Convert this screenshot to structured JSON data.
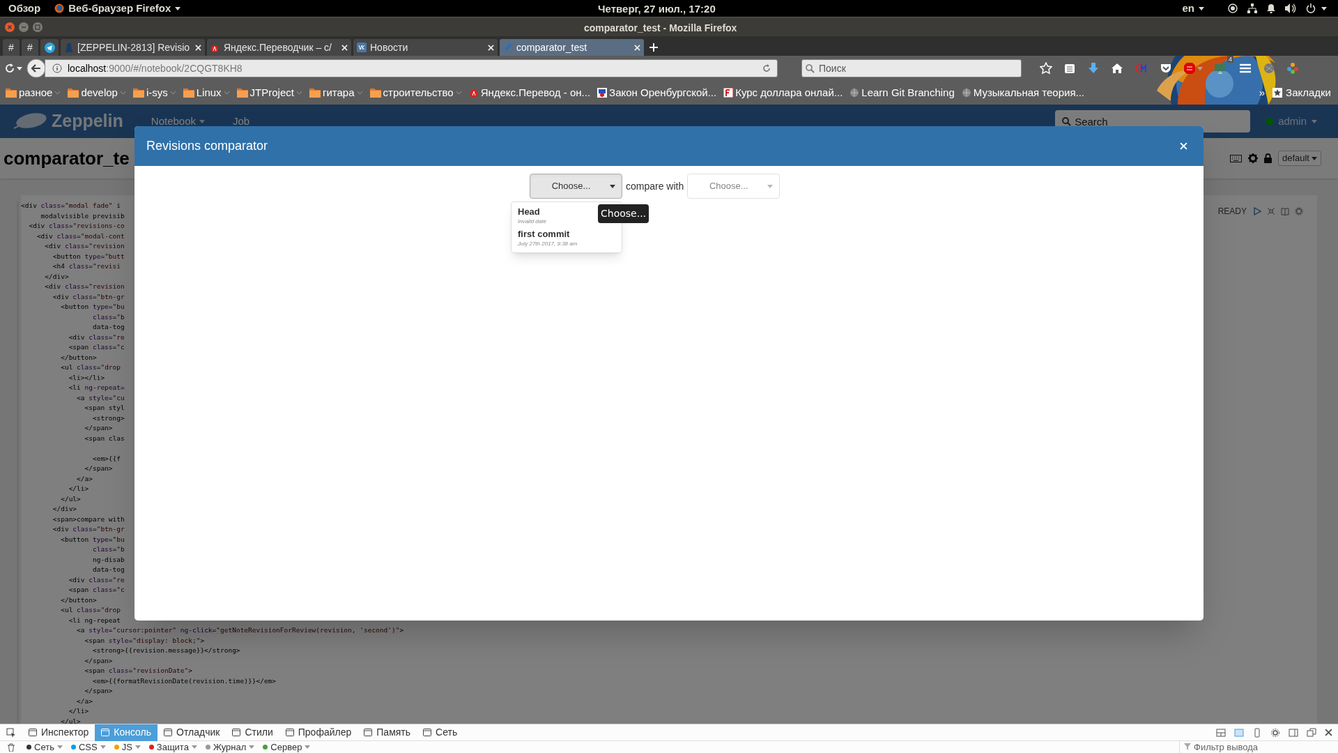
{
  "system_bar": {
    "activities": "Обзор",
    "app_menu": "Веб-браузер Firefox",
    "clock": "Четверг, 27 июл., 17:20",
    "language": "en"
  },
  "window": {
    "title": "comparator_test - Mozilla Firefox"
  },
  "tabs": [
    {
      "kind": "pinned",
      "label": "#",
      "selected": false
    },
    {
      "kind": "pinned",
      "label": "#",
      "selected": false
    },
    {
      "kind": "pinned-icon",
      "selected": false
    },
    {
      "kind": "page",
      "label": "[ZEPPELIN-2813] Revisio",
      "selected": false
    },
    {
      "kind": "page",
      "label": "Яндекс.Переводчик – с/",
      "selected": false
    },
    {
      "kind": "page",
      "label": "Новости",
      "selected": false
    },
    {
      "kind": "page",
      "label": "comparator_test",
      "selected": true
    }
  ],
  "address_bar": {
    "host": "localhost",
    "path": ":9000/#/notebook/2CQGT8KH8"
  },
  "search": {
    "placeholder": "Поиск"
  },
  "toolbar_badge": "4",
  "bookmarks": [
    {
      "kind": "folder",
      "label": "разное"
    },
    {
      "kind": "folder",
      "label": "develop"
    },
    {
      "kind": "folder",
      "label": "i-sys"
    },
    {
      "kind": "folder",
      "label": "Linux"
    },
    {
      "kind": "folder",
      "label": "JTProject"
    },
    {
      "kind": "folder",
      "label": "гитара"
    },
    {
      "kind": "folder",
      "label": "строительство"
    },
    {
      "kind": "site",
      "label": "Яндекс.Перевод - он..."
    },
    {
      "kind": "site",
      "label": "Закон Оренбургской..."
    },
    {
      "kind": "site",
      "label": "Курс доллара онлай..."
    },
    {
      "kind": "site",
      "label": "Learn Git Branching"
    },
    {
      "kind": "site",
      "label": "Музыкальная теория..."
    }
  ],
  "bookmarks_overflow": "»",
  "bookmarks_menu": "Закладки",
  "zeppelin": {
    "brand": "Zeppelin",
    "menu": [
      {
        "label": "Notebook",
        "dropdown": true
      },
      {
        "label": "Job",
        "dropdown": false
      }
    ],
    "search": {
      "placeholder": "Search"
    },
    "user": "admin",
    "note_title": "comparator_te",
    "interpreter": "default",
    "paragraph_status": "READY",
    "code_lines": [
      {
        "text": "<div class=\"modal fade\" i"
      },
      {
        "text": "     modalvisible previsib"
      },
      {
        "text": "  <div class=\"revisions-co"
      },
      {
        "text": "    <div class=\"modal-cont"
      },
      {
        "text": "      <div class=\"revision"
      },
      {
        "text": "        <button type=\"butt"
      },
      {
        "text": "        <h4 class=\"revisi"
      },
      {
        "text": "      </div>"
      },
      {
        "text": "      <div class=\"revision"
      },
      {
        "text": "        <div class=\"btn-gr"
      },
      {
        "text": "          <button type=\"bu"
      },
      {
        "text": "                  class=\"b"
      },
      {
        "text": "                  data-tog"
      },
      {
        "text": "            <div class=\"re"
      },
      {
        "text": "            <span class=\"c"
      },
      {
        "text": "          </button>"
      },
      {
        "text": "          <ul class=\"drop"
      },
      {
        "text": "            <li></li>"
      },
      {
        "text": "            <li ng-repeat="
      },
      {
        "text": "              <a style=\"cu"
      },
      {
        "text": "                <span styl"
      },
      {
        "text": "                  <strong>"
      },
      {
        "text": "                </span>"
      },
      {
        "text": "                <span clas"
      },
      {
        "text": "                  <em>{{f",
        "gap_before": true
      },
      {
        "text": "                </span>"
      },
      {
        "text": "              </a>"
      },
      {
        "text": "            </li>"
      },
      {
        "text": "          </ul>"
      },
      {
        "text": "        </div>"
      },
      {
        "text": "        <span>compare with"
      },
      {
        "text": "        <div class=\"btn-gr"
      },
      {
        "text": "          <button type=\"bu"
      },
      {
        "text": "                  class=\"b"
      },
      {
        "text": "                  ng-disab"
      },
      {
        "text": "                  data-tog"
      },
      {
        "text": "            <div class=\"re"
      },
      {
        "text": "            <span class=\"c"
      },
      {
        "text": "          </button>"
      },
      {
        "text": "          <ul class=\"drop"
      },
      {
        "text": "            <li ng-repeat"
      },
      {
        "text": "              <a style=\"cursor:pointer\" ng-click=\"getNoteRevisionForReview(revision, 'second')\">"
      },
      {
        "text": "                <span style=\"display: block;\">"
      },
      {
        "text": "                  <strong>{{revision.message}}</strong>"
      },
      {
        "text": "                </span>"
      },
      {
        "text": "                <span class=\"revisionDate\">"
      },
      {
        "text": "                  <em>{{formatRevisionDate(revision.time)}}</em>"
      },
      {
        "text": "                </span>"
      },
      {
        "text": "              </a>"
      },
      {
        "text": "            </li>"
      },
      {
        "text": "          </ul>"
      }
    ]
  },
  "modal": {
    "title": "Revisions comparator",
    "first": {
      "label": "Choose...",
      "active": true
    },
    "compare_label": "compare with",
    "second": {
      "label": "Choose...",
      "disabled": true
    },
    "revisions": [
      {
        "message": "Head",
        "date": "Invalid date"
      },
      {
        "message": "first commit",
        "date": "July 27th 2017, 9:38 am"
      }
    ],
    "tooltip": "Choose..."
  },
  "devtools": {
    "tabs": [
      {
        "label": "Инспектор",
        "selected": false
      },
      {
        "label": "Консоль",
        "selected": true
      },
      {
        "label": "Отладчик",
        "selected": false
      },
      {
        "label": "Стили",
        "selected": false
      },
      {
        "label": "Профайлер",
        "selected": false
      },
      {
        "label": "Память",
        "selected": false
      },
      {
        "label": "Сеть",
        "selected": false
      }
    ],
    "filters": [
      {
        "label": "Сеть",
        "color": "#333333"
      },
      {
        "label": "CSS",
        "color": "#00a0e6"
      },
      {
        "label": "JS",
        "color": "#f0a000"
      },
      {
        "label": "Защита",
        "color": "#e02020"
      },
      {
        "label": "Журнал",
        "color": "#999999"
      },
      {
        "label": "Сервер",
        "color": "#44a044"
      }
    ],
    "filter_placeholder": "Фильтр вывода"
  }
}
